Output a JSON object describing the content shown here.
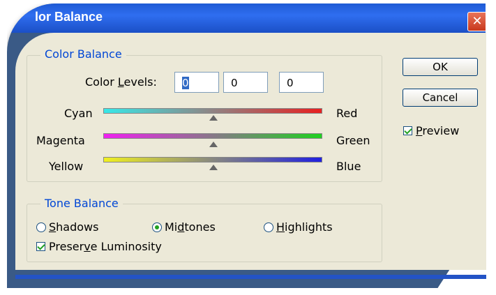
{
  "window": {
    "title": "lor Balance",
    "close_glyph": "✕"
  },
  "color_balance": {
    "legend": "Color Balance",
    "levels_label": "Color Levels:",
    "levels": [
      "0",
      "0",
      "0"
    ],
    "sliders": [
      {
        "left": "Cyan",
        "right": "Red",
        "value": 0,
        "gradient": [
          "#38e8e8",
          "#e82020"
        ]
      },
      {
        "left": "Magenta",
        "right": "Green",
        "value": 0,
        "gradient": [
          "#f020f0",
          "#20d020"
        ]
      },
      {
        "left": "Yellow",
        "right": "Blue",
        "value": 0,
        "gradient": [
          "#f0f020",
          "#2020e0"
        ]
      }
    ]
  },
  "tone_balance": {
    "legend": "Tone Balance",
    "options": [
      "Shadows",
      "Midtones",
      "Highlights"
    ],
    "selected": "Midtones",
    "preserve_luminosity": {
      "label": "Preserve Luminosity",
      "checked": true
    }
  },
  "buttons": {
    "ok": "OK",
    "cancel": "Cancel"
  },
  "preview": {
    "label": "Preview",
    "checked": true
  }
}
